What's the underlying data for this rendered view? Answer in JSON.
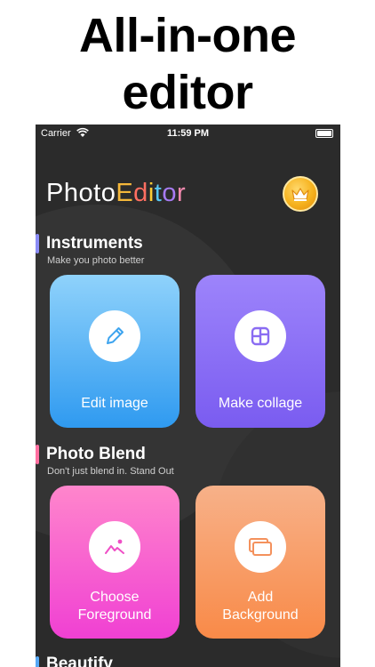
{
  "headline": {
    "line1": "All-in-one",
    "line2": "editor"
  },
  "status_bar": {
    "carrier": "Carrier",
    "time": "11:59 PM"
  },
  "app": {
    "logo_letters": [
      "P",
      "h",
      "o",
      "t",
      "o",
      "E",
      "d",
      "i",
      "t",
      "o",
      "r"
    ],
    "logo_colors": [
      "#ffffff",
      "#ffffff",
      "#ffffff",
      "#ffffff",
      "#ffffff",
      "#f4b73a",
      "#ff6f61",
      "#ffcc33",
      "#58c6f2",
      "#a77bf3",
      "#f58ab0"
    ]
  },
  "sections": {
    "instruments": {
      "title": "Instruments",
      "subtitle": "Make you photo better",
      "bar_color": "#8a8cf6"
    },
    "photo_blend": {
      "title": "Photo Blend",
      "subtitle": "Don't just blend in. Stand Out",
      "bar_color": "#ff6fa0"
    },
    "beautify": {
      "title": "Beautify",
      "bar_color": "#57a8f5"
    }
  },
  "cards": {
    "edit_image": {
      "label": "Edit image",
      "icon": "pencil-icon",
      "color_top": "#8fd2fb",
      "color_bottom": "#2f9af0",
      "icon_color": "#3da4ef"
    },
    "make_collage": {
      "label": "Make collage",
      "icon": "grid-icon",
      "color_top": "#9d84fb",
      "color_bottom": "#7a5cf0",
      "icon_color": "#8a6cf2"
    },
    "choose_foreground": {
      "label_line1": "Choose",
      "label_line2": "Foreground",
      "icon": "image-icon",
      "color_top": "#ff86cc",
      "color_bottom": "#f040d3",
      "icon_color": "#ef4fc6"
    },
    "add_background": {
      "label_line1": "Add",
      "label_line2": "Background",
      "icon": "layers-icon",
      "color_top": "#f7b189",
      "color_bottom": "#f98a48",
      "icon_color": "#f4915c"
    }
  }
}
